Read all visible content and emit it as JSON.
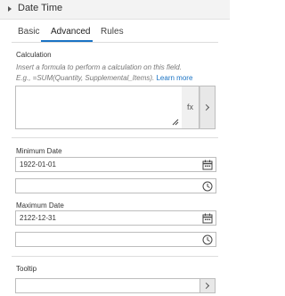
{
  "header": {
    "title": "Date Time"
  },
  "tabs": [
    {
      "label": "Basic",
      "active": false
    },
    {
      "label": "Advanced",
      "active": true
    },
    {
      "label": "Rules",
      "active": false
    }
  ],
  "calculation": {
    "label": "Calculation",
    "help_line1": "Insert a formula to perform a calculation on this field.",
    "help_line2": "E.g., =SUM(Quantity, Supplemental_Items).",
    "learn_more": "Learn more",
    "value": "",
    "fx_label": "fx"
  },
  "minimum_date": {
    "label": "Minimum Date",
    "date_value": "1922-01-01",
    "time_value": ""
  },
  "maximum_date": {
    "label": "Maximum Date",
    "date_value": "2122-12-31",
    "time_value": ""
  },
  "tooltip": {
    "label": "Tooltip",
    "value": ""
  },
  "colors": {
    "accent": "#1a73c4",
    "border": "#bdbdbd",
    "header_bg": "#f3f3f3"
  }
}
